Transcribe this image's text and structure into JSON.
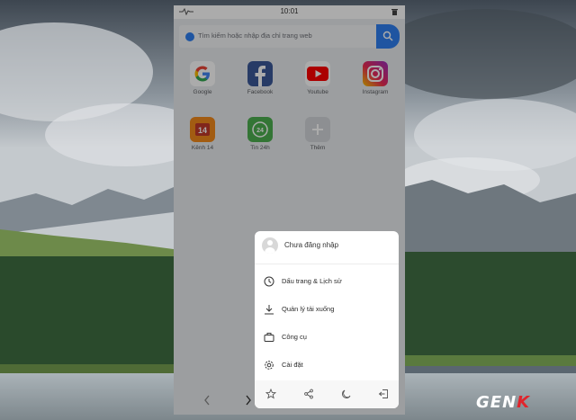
{
  "status_bar": {
    "time": "10:01",
    "left_icon": "signal-pulse-icon",
    "right_icon": "trash-icon"
  },
  "search": {
    "placeholder": "Tìm kiếm hoặc nhập địa chỉ trang web",
    "button_icon": "search-icon"
  },
  "shortcuts": [
    {
      "label": "Google",
      "icon": "google-icon"
    },
    {
      "label": "Facebook",
      "icon": "facebook-icon"
    },
    {
      "label": "Youtube",
      "icon": "youtube-icon"
    },
    {
      "label": "Instagram",
      "icon": "instagram-icon"
    },
    {
      "label": "Kênh 14",
      "icon": "kenh14-icon",
      "badge": "14"
    },
    {
      "label": "Tin 24h",
      "icon": "tin24h-icon",
      "badge": "24"
    },
    {
      "label": "Thêm",
      "icon": "plus-icon"
    }
  ],
  "menu": {
    "user_label": "Chưa đăng nhập",
    "items": [
      {
        "label": "Dấu trang & Lịch sử",
        "icon": "clock-icon"
      },
      {
        "label": "Quản lý tải xuống",
        "icon": "download-icon"
      },
      {
        "label": "Công cụ",
        "icon": "briefcase-icon"
      },
      {
        "label": "Cài đặt",
        "icon": "gear-icon"
      }
    ],
    "toolbar": [
      "star-icon",
      "share-icon",
      "moon-icon",
      "exit-icon"
    ]
  },
  "nav_icons": [
    "back-arrow-icon",
    "forward-arrow-icon"
  ],
  "watermark": {
    "prefix": "GEN",
    "suffix": "K"
  },
  "colors": {
    "accent": "#2f7ff0",
    "facebook": "#3b5998",
    "youtube": "#ff0000",
    "kenh14": "#f28a1c",
    "tin24h": "#4caf50",
    "watermark_k": "#e0252c"
  }
}
